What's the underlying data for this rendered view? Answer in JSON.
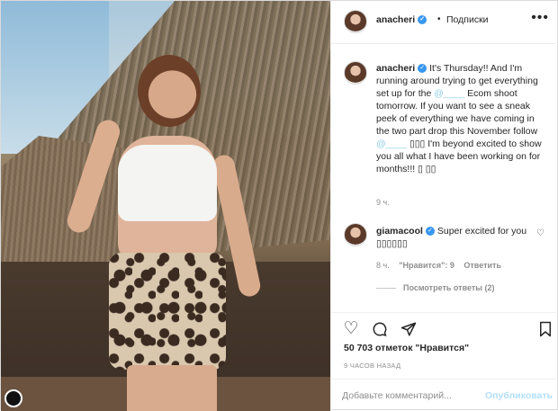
{
  "header": {
    "username": "anacheri",
    "separator": "•",
    "follow_label": "Подписки",
    "more_icon": "more-dots-icon",
    "verified_icon": "verified-badge-icon"
  },
  "caption": {
    "username": "anacheri",
    "text_part1": "It's Thursday!! And I'm running around trying to get everything set up for the ",
    "blurred_mention_1": "@‌‌____",
    "text_part2": " Ecom shoot tomorrow. If you want to see a sneak peek of everything we have coming in the two part drop this November follow ",
    "blurred_mention_2": "@‌____",
    "text_part3": " ▯▯▯ I'm beyond excited to show you all what I have been working on for months!!! ▯ ▯▯",
    "time": "9 ч."
  },
  "reply": {
    "username": "giamacool",
    "text": "Super excited for you ▯▯▯▯▯▯",
    "time": "8 ч.",
    "likes": "\"Нравится\": 9",
    "reply_label": "Ответить",
    "view_replies": "Посмотреть ответы (2)",
    "heart_icon": "heart-outline-icon"
  },
  "actions": {
    "icons": [
      "heart-outline-icon",
      "comment-bubble-icon",
      "share-plane-icon",
      "bookmark-icon"
    ],
    "likes_count": "50 703 отметок \"Нравится\"",
    "posted_ago": "9 ЧАСОВ НАЗАД"
  },
  "add_comment": {
    "placeholder": "Добавьте комментарий...",
    "post_label": "Опубликовать"
  },
  "colors": {
    "verified": "#3897f0",
    "post_disabled": "#b2dffc",
    "muted": "#8e8e8e"
  }
}
